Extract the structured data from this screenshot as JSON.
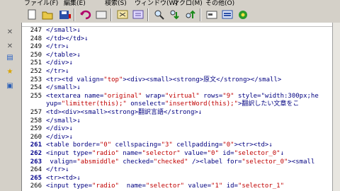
{
  "menubar": [
    "ファイル(F)",
    "編集(E)",
    "検索(S)",
    "ウィンドウ(W)",
    "マクロ(M)",
    "その他(O)"
  ],
  "toolbar_icons": [
    "new-file-icon",
    "open-folder-icon",
    "save-icon",
    "undo-icon",
    "redo-icon",
    "cut-icon",
    "copy-icon",
    "paste-icon",
    "search-icon",
    "search-down-icon",
    "search-up-icon",
    "replace-icon",
    "window-icon",
    "config-icon"
  ],
  "left_icons": [
    "close-icon",
    "close-icon-2",
    "page-icon",
    "star-icon",
    "explorer-icon"
  ],
  "lines": [
    {
      "n": "247",
      "t": "</small>↓"
    },
    {
      "n": "248",
      "t": "</td></td>↓"
    },
    {
      "n": "249",
      "t": "</tr>↓"
    },
    {
      "n": "250",
      "t": "</table>↓"
    },
    {
      "n": "251",
      "t": "</div>↓"
    },
    {
      "n": "252",
      "t": "</tr>↓"
    },
    {
      "n": "253",
      "t": "<tr><td valign=\"top\"><div><small><strong>原文</strong></small>"
    },
    {
      "n": "254",
      "t": "</small>↓"
    },
    {
      "n": "255",
      "t": "<textarea name=\"original\" wrap=\"virtual\" rows=\"9\" style=\"width:300px;he"
    },
    {
      "n": "",
      "t": "yup=\"limitter(this);\" onselect=\"insertWord(this);\">翻訳したい文章をこ"
    },
    {
      "n": "257",
      "t": "<td><div><small><strong>翻訳言語</strong>↓"
    },
    {
      "n": "258",
      "t": "</small>↓"
    },
    {
      "n": "259",
      "t": "</div>↓"
    },
    {
      "n": "260",
      "t": "</div>↓"
    },
    {
      "n": "261",
      "t": "<table border=\"0\" cellspacing=\"3\" cellpadding=\"0\"><tr><td>↓"
    },
    {
      "n": "262",
      "t": "<input type=\"radio\" name=\"selector\" value=\"0\" id=\"selector_0\"↓"
    },
    {
      "n": "263",
      "t": " valign=\"absmiddle\" checked=\"checked\" /><label for=\"selector_0\"><small"
    },
    {
      "n": "264",
      "t": "</tr>↓"
    },
    {
      "n": "265",
      "t": "<tr><td>↓"
    },
    {
      "n": "266",
      "t": "<input type=\"radio\"  name=\"selector\" value=\"1\" id=\"selector_1\""
    }
  ],
  "highlight_lines": [
    "261",
    "262",
    "263",
    "265"
  ]
}
